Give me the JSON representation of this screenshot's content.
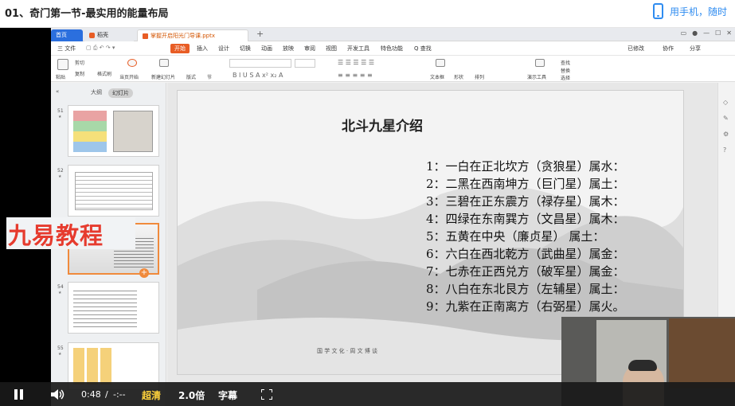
{
  "header": {
    "title": "01、奇门第一节-最实用的能量布局",
    "phone_link": "用手机，随时"
  },
  "wps": {
    "tabs": [
      {
        "label": "首页"
      },
      {
        "label": "稻壳"
      },
      {
        "label": "掌握开启阳光门导课.pptx"
      }
    ],
    "menus": [
      "三 文件",
      "开始",
      "插入",
      "设计",
      "切换",
      "动画",
      "放映",
      "审阅",
      "视图",
      "开发工具",
      "特色功能",
      "Q 查找"
    ],
    "top_right": [
      "已修改",
      "协作",
      "分享"
    ],
    "ribbon": [
      "粘贴",
      "剪切",
      "复制",
      "格式刷",
      "当页开始",
      "新建幻灯片",
      "版式",
      "节",
      "文本框",
      "形状",
      "排列",
      "演示工具",
      "替换",
      "选择",
      "查找"
    ],
    "panel_tabs": [
      "大纲",
      "幻灯片"
    ],
    "thumb_numbers": [
      "51",
      "52",
      "53",
      "54",
      "55"
    ]
  },
  "slide": {
    "title": "北斗九星介绍",
    "lines": [
      "1：一白在正北坎方（贪狼星）属水：",
      "2：二黑在西南坤方（巨门星）属土：",
      "3：三碧在正东震方（禄存星）属木：",
      "4：四绿在东南巽方（文昌星）属木：",
      "5：五黄在中央（廉贞星） 属土：",
      "6：六白在西北乾方（武曲星）属金：",
      "7：七赤在正西兑方（破军星）属金：",
      "8：八白在东北艮方（左辅星）属土：",
      "9：九紫在正南离方（右弼星）属火。"
    ],
    "footer": "国 学 文 化 · 周 文 博 谈"
  },
  "watermark": "九易教程",
  "player": {
    "time_current": "0:48",
    "time_sep": "/",
    "time_total": "-:--",
    "quality": "超清",
    "speed": "2.0倍",
    "subtitle": "字幕"
  }
}
